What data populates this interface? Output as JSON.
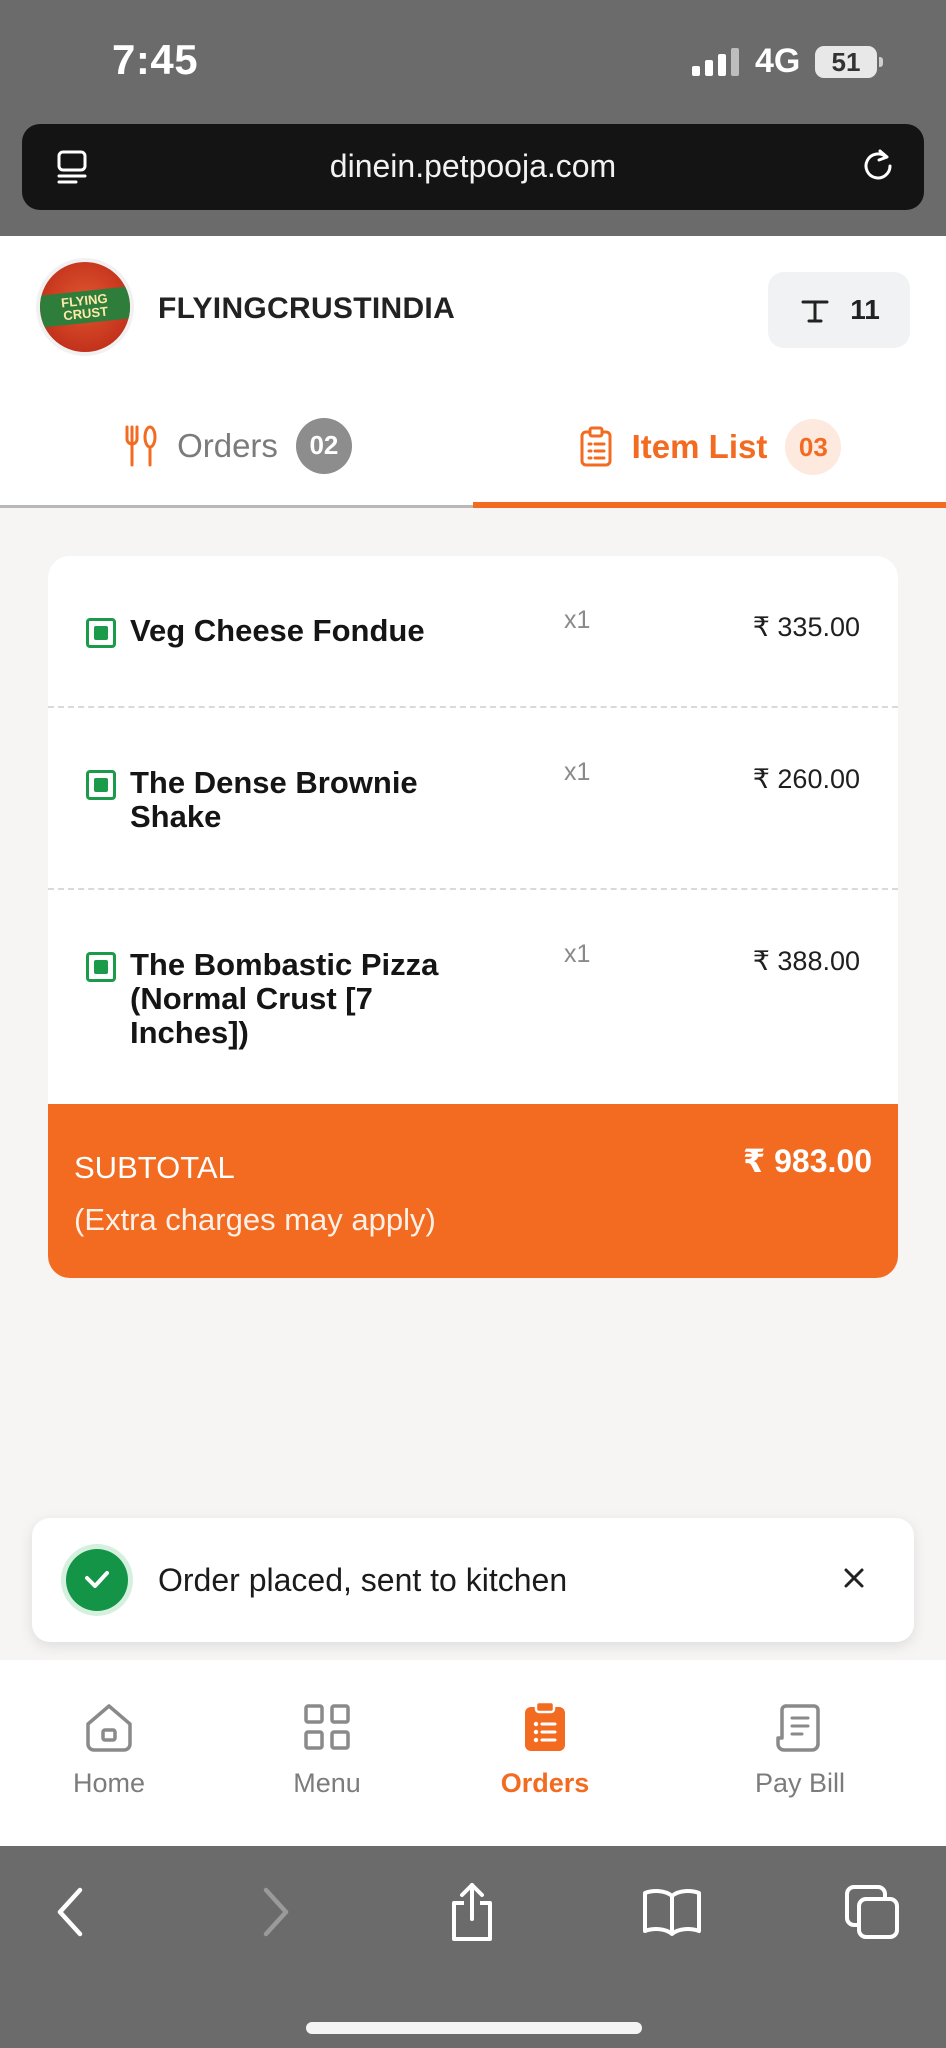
{
  "status_bar": {
    "time": "7:45",
    "network": "4G",
    "battery": "51"
  },
  "browser": {
    "url": "dinein.petpooja.com"
  },
  "header": {
    "logo_text": "FLYING CRUST",
    "restaurant_name": "FLYINGCRUSTINDIA",
    "table_number": "11"
  },
  "tabs": [
    {
      "label": "Orders",
      "count": "02",
      "active": false
    },
    {
      "label": "Item List",
      "count": "03",
      "active": true
    }
  ],
  "items": [
    {
      "name": "Veg Cheese Fondue",
      "qty": "x1",
      "price": "₹ 335.00",
      "veg": true
    },
    {
      "name": "The Dense Brownie Shake",
      "qty": "x1",
      "price": "₹ 260.00",
      "veg": true
    },
    {
      "name": "The Bombastic Pizza (Normal Crust [7 Inches])",
      "qty": "x1",
      "price": "₹ 388.00",
      "veg": true
    }
  ],
  "subtotal": {
    "label": "SUBTOTAL",
    "note": "(Extra charges may apply)",
    "amount": "₹ 983.00"
  },
  "toast": {
    "message": "Order placed, sent to kitchen"
  },
  "bottom_nav": [
    {
      "label": "Home",
      "icon": "home-icon",
      "active": false
    },
    {
      "label": "Menu",
      "icon": "grid-icon",
      "active": false
    },
    {
      "label": "Orders",
      "icon": "clipboard-list-icon",
      "active": true
    },
    {
      "label": "Pay Bill",
      "icon": "receipt-icon",
      "active": false
    }
  ],
  "colors": {
    "accent": "#f26b21",
    "veg": "#1a9b4a",
    "success": "#139447",
    "browser_chrome": "#6b6b6b"
  }
}
